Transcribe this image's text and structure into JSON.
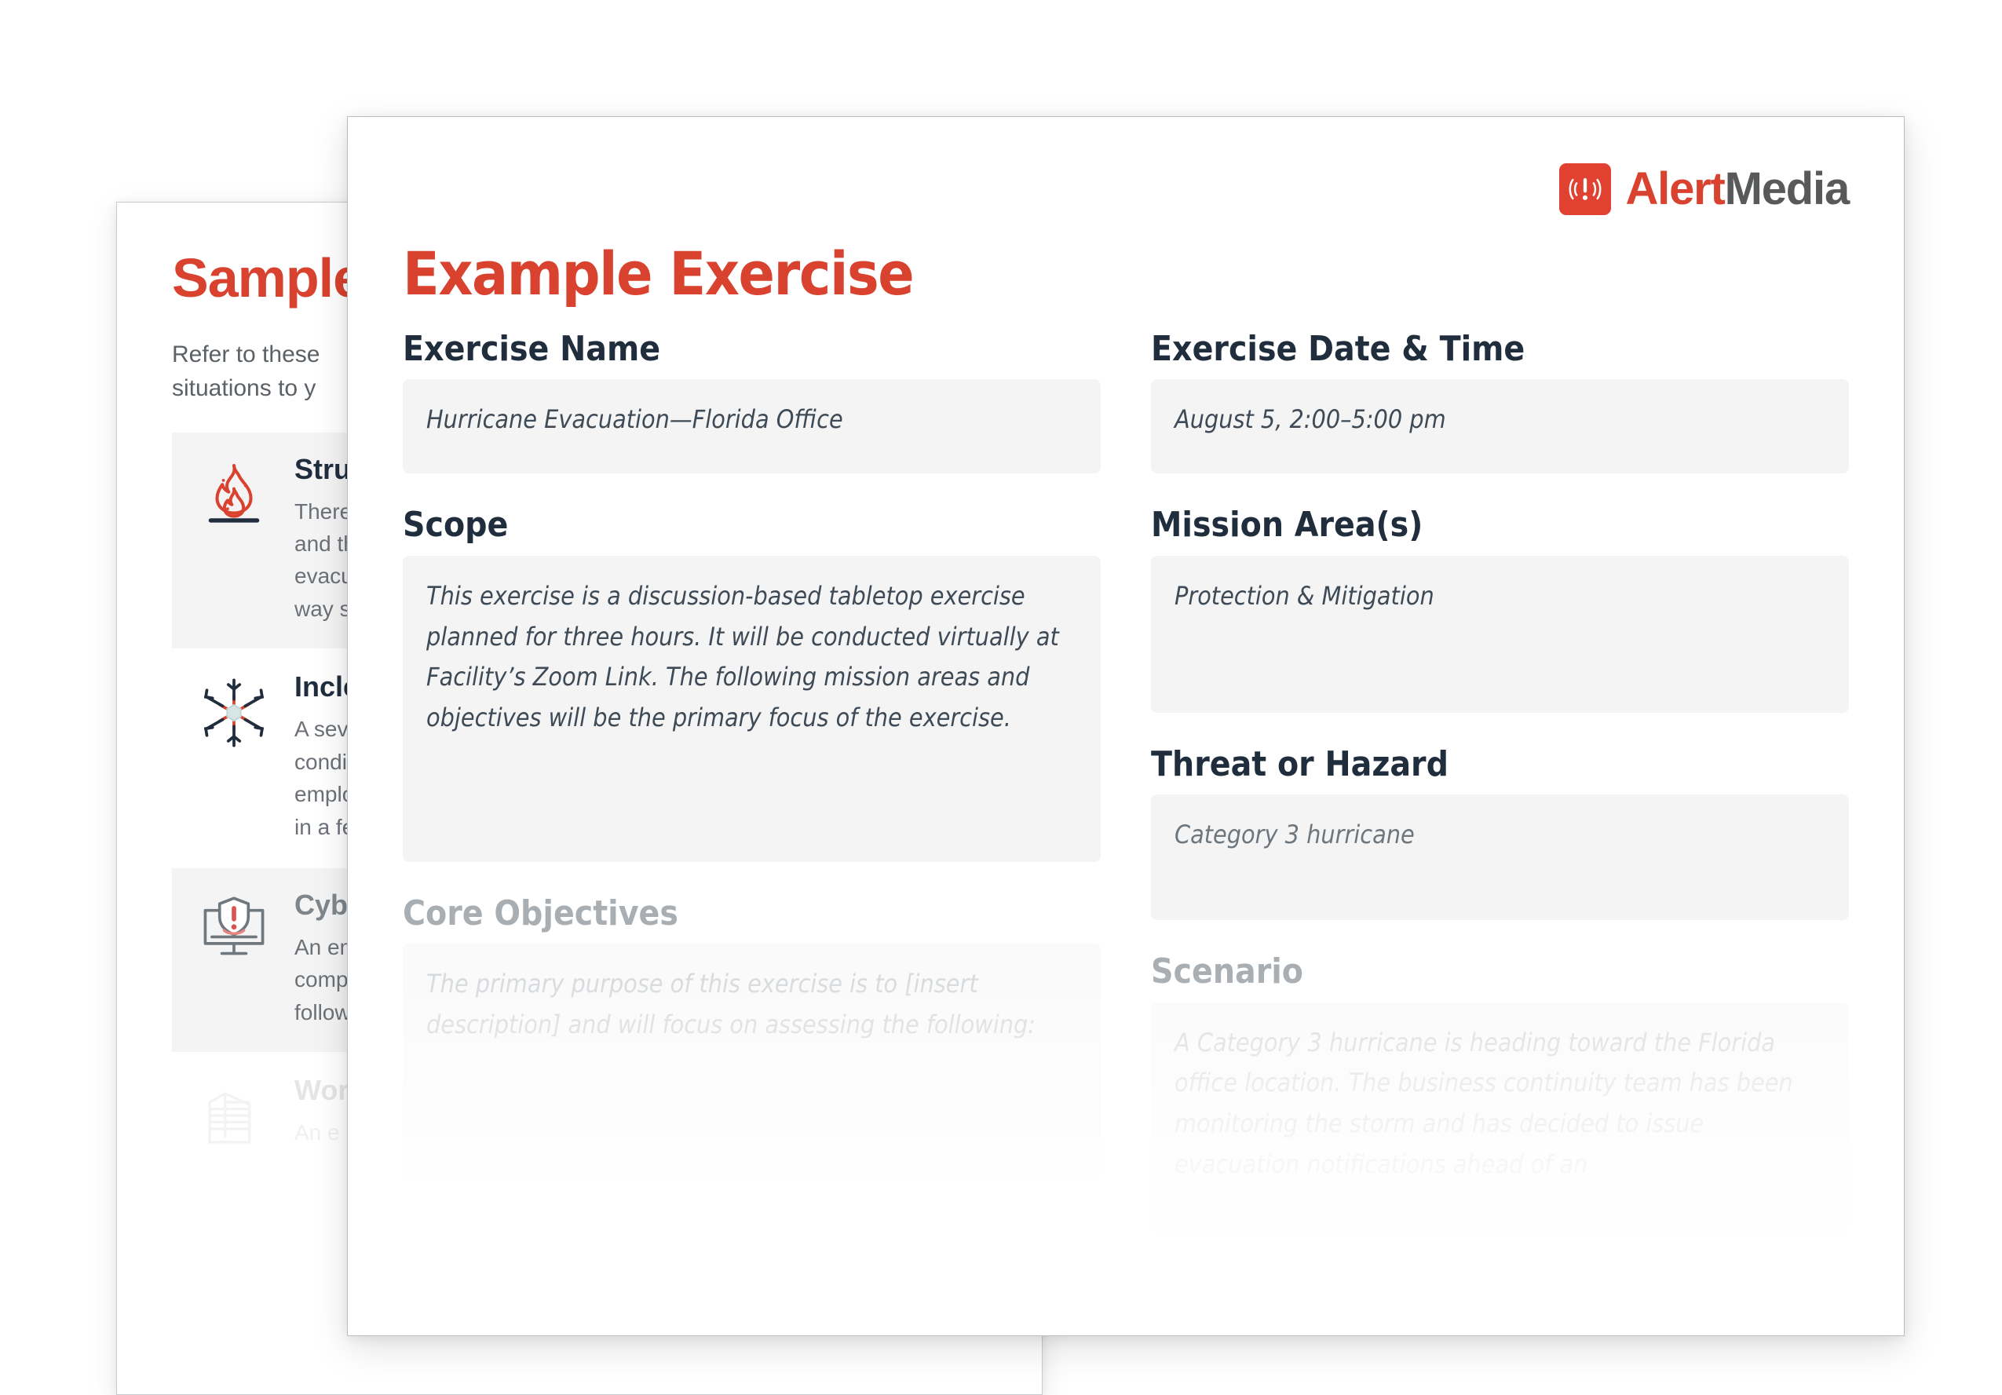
{
  "back_page": {
    "title": "Sample",
    "intro_lines": [
      "Refer to these",
      "situations to y"
    ],
    "scenarios": [
      {
        "icon": "fire-icon",
        "heading": "Stru",
        "lines": [
          "There",
          "and th",
          "evacu",
          "way s"
        ]
      },
      {
        "icon": "snowflake-icon",
        "heading": "Incle",
        "lines": [
          "A sev",
          "condi",
          "emplo",
          "in a fe"
        ]
      },
      {
        "icon": "cyber-monitor-icon",
        "heading": "Cyb",
        "lines": [
          "An em",
          "comp",
          "follow"
        ]
      },
      {
        "icon": "office-building-icon",
        "heading": "Wor",
        "lines": [
          "An e"
        ]
      }
    ]
  },
  "front_page": {
    "logo": {
      "icon": "alert-speaker-icon",
      "word_primary": "Alert",
      "word_secondary": "Media"
    },
    "title": "Example Exercise",
    "left_column": [
      {
        "label": "Exercise Name",
        "value": "Hurricane Evacuation—Florida Office",
        "state": "normal",
        "size": "h-name"
      },
      {
        "label": "Scope",
        "value": "This exercise is a discussion-based tabletop exercise planned for three hours. It will be conducted virtually at Facility’s Zoom Link. The following mission areas and objectives will be the primary focus of the exercise.",
        "state": "normal",
        "size": "h-scope"
      },
      {
        "label": "Core Objectives",
        "value": "The primary purpose of this exercise is to [insert description] and will focus on assessing the following:",
        "state": "ghost",
        "size": "h-big"
      }
    ],
    "right_column": [
      {
        "label": "Exercise Date & Time",
        "value": "August 5, 2:00–5:00 pm",
        "state": "normal",
        "size": "h-date"
      },
      {
        "label": "Mission Area(s)",
        "value": "Protection & Mitigation",
        "state": "normal",
        "size": "h-mission"
      },
      {
        "label": "Threat or Hazard",
        "value": "Category 3 hurricane",
        "state": "dim",
        "size": "h-threat"
      },
      {
        "label": "Scenario",
        "value": "A Category 3 hurricane is heading toward the Florida office location. The business continuity team has been monitoring the storm and has decided to issue evacuation notifications ahead of an",
        "state": "ghost",
        "size": "h-big"
      }
    ]
  },
  "colors": {
    "brand_red": "#d9422e",
    "logo_red": "#e04130",
    "logo_gray": "#58595b",
    "heading_navy": "#1f2d3d",
    "field_bg": "#f4f4f4",
    "body_gray": "#6b7177"
  }
}
